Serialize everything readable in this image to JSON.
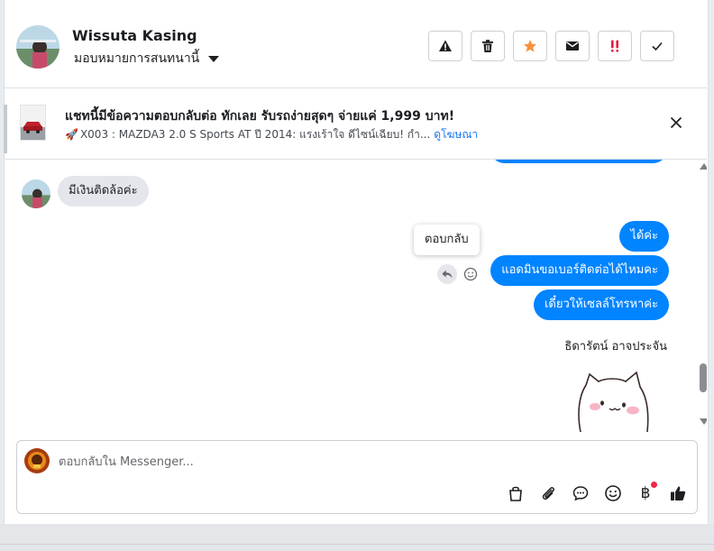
{
  "header": {
    "user_name": "Wissuta Kasing",
    "assign_label": "มอบหมายการสนทนานี้",
    "actions": [
      "warning-button",
      "delete-button",
      "star-button",
      "mail-button",
      "spam-button",
      "done-button"
    ]
  },
  "ad": {
    "title": "แชทนี้มีข้อความตอบกลับต่อ ทักเลย รับรถง่ายสุดๆ จ่ายแค่ 1,999 บาท!",
    "subtitle": "X003 : MAZDA3 2.0 S Sports AT ปี 2014: แรงเร้าใจ ดีไซน์เฉียบ! กำ...",
    "link": "ดูโฆษณา"
  },
  "chat": {
    "incoming": "มีเงินติดล้อค่ะ",
    "tooltip": "ตอบกลับ",
    "outgoing": [
      "ได้ค่ะ",
      "แอดมินขอเบอร์ติดต่อได้ไหมคะ",
      "เดี๋ยวให้เซลล์โทรหาค่ะ"
    ],
    "sender_name": "ธิดารัตน์ อาจประจัน"
  },
  "composer": {
    "placeholder": "ตอบกลับใน Messenger...",
    "currency_symbol": "฿"
  },
  "colors": {
    "accent": "#0084ff",
    "star": "#f7923a",
    "spam": "#e41e3f",
    "notification_dot": "#f02849"
  }
}
